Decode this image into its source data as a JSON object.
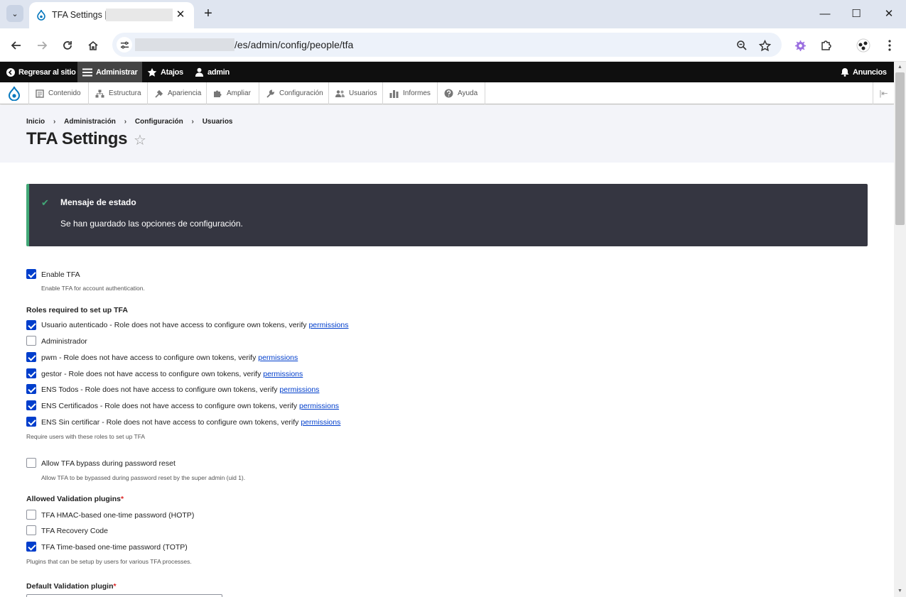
{
  "browser": {
    "tab_title": "TFA Settings |",
    "url_path": "/es/admin/config/people/tfa"
  },
  "admin_bar": {
    "back_label": "Regresar al sitio",
    "manage_label": "Administrar",
    "shortcuts_label": "Atajos",
    "user_label": "admin",
    "announcements_label": "Anuncios"
  },
  "menu": {
    "items": [
      "Contenido",
      "Estructura",
      "Apariencia",
      "Ampliar",
      "Configuración",
      "Usuarios",
      "Informes",
      "Ayuda"
    ]
  },
  "breadcrumb": [
    "Inicio",
    "Administración",
    "Configuración",
    "Usuarios"
  ],
  "page_title": "TFA Settings",
  "status": {
    "title": "Mensaje de estado",
    "text": "Se han guardado las opciones de configuración."
  },
  "form": {
    "enable": {
      "label": "Enable TFA",
      "description": "Enable TFA for account authentication.",
      "checked": true
    },
    "roles": {
      "label": "Roles required to set up TFA",
      "link_text": "permissions",
      "items": [
        {
          "text": "Usuario autenticado - Role does not have access to configure own tokens, verify ",
          "checked": true,
          "link": true
        },
        {
          "text": "Administrador",
          "checked": false,
          "link": false
        },
        {
          "text": "pwm - Role does not have access to configure own tokens, verify ",
          "checked": true,
          "link": true
        },
        {
          "text": "gestor - Role does not have access to configure own tokens, verify ",
          "checked": true,
          "link": true
        },
        {
          "text": "ENS Todos - Role does not have access to configure own tokens, verify ",
          "checked": true,
          "link": true
        },
        {
          "text": "ENS Certificados - Role does not have access to configure own tokens, verify ",
          "checked": true,
          "link": true
        },
        {
          "text": "ENS Sin certificar - Role does not have access to configure own tokens, verify ",
          "checked": true,
          "link": true
        }
      ],
      "description": "Require users with these roles to set up TFA"
    },
    "bypass": {
      "label": "Allow TFA bypass during password reset",
      "description": "Allow TFA to be bypassed during password reset by the super admin (uid 1).",
      "checked": false
    },
    "plugins": {
      "label": "Allowed Validation plugins",
      "required_mark": "*",
      "items": [
        {
          "text": "TFA HMAC-based one-time password (HOTP)",
          "checked": false
        },
        {
          "text": "TFA Recovery Code",
          "checked": false
        },
        {
          "text": "TFA Time-based one-time password (TOTP)",
          "checked": true
        }
      ],
      "description": "Plugins that can be setup by users for various TFA processes."
    },
    "default_plugin": {
      "label": "Default Validation plugin",
      "required_mark": "*"
    }
  },
  "icons": {
    "tab_favicon": "drupal-drop-icon",
    "colors": {
      "accent": "#003ecc",
      "success": "#42a877",
      "status_bg": "#353641",
      "required": "#dc2323"
    }
  }
}
